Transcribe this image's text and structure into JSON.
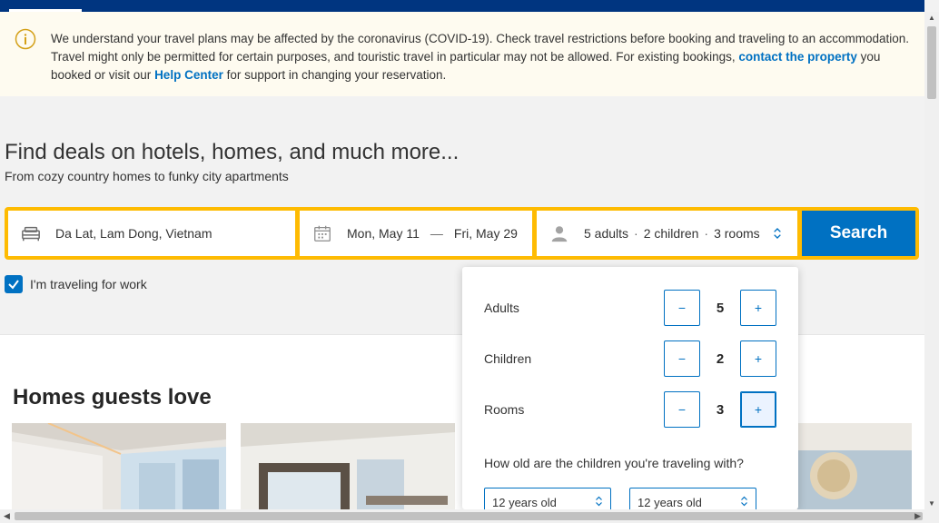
{
  "notice": {
    "text_before": "We understand your travel plans may be affected by the coronavirus (COVID-19). Check travel restrictions before booking and traveling to an accommodation. Travel might only be permitted for certain purposes, and touristic travel in particular may not be allowed. For existing bookings, ",
    "link_contact": "contact the property",
    "text_middle": " you booked or visit our ",
    "link_help": "Help Center",
    "text_after": " for support in changing your reservation.",
    "icon": "info-icon"
  },
  "hero": {
    "title": "Find deals on hotels, homes, and much more...",
    "subtitle": "From cozy country homes to funky city apartments"
  },
  "search": {
    "destination": "Da Lat, Lam Dong, Vietnam",
    "checkin": "Mon, May 11",
    "date_separator": "—",
    "checkout": "Fri, May 29",
    "guests": {
      "adults": "5 adults",
      "dot1": "·",
      "children": "2 children",
      "dot2": "·",
      "rooms": "3 rooms"
    },
    "button_label": "Search",
    "work_travel_label": "I'm traveling for work",
    "work_travel_checked": true
  },
  "section": {
    "homes_title": "Homes guests love"
  },
  "guest_popup": {
    "rows": [
      {
        "label": "Adults",
        "value": "5",
        "minus": "−",
        "plus": "+"
      },
      {
        "label": "Children",
        "value": "2",
        "minus": "−",
        "plus": "+"
      },
      {
        "label": "Rooms",
        "value": "3",
        "minus": "−",
        "plus": "+"
      }
    ],
    "children_question": "How old are the children you're traveling with?",
    "child_ages": [
      "12 years old",
      "12 years old"
    ]
  },
  "colors": {
    "brand_dark": "#003580",
    "brand_blue": "#0071c2",
    "search_border": "#febb02",
    "notice_bg": "#fefbf0"
  }
}
